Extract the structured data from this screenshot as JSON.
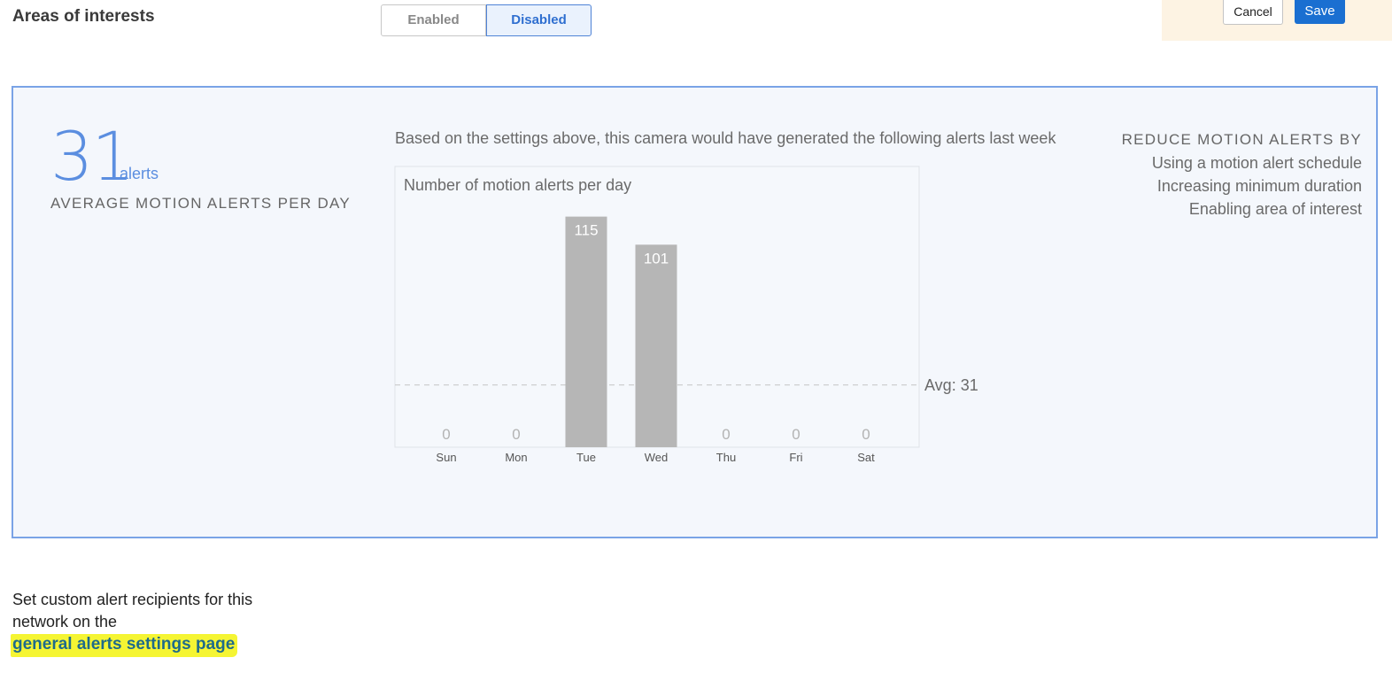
{
  "header": {
    "title": "Areas of interests",
    "toggle": {
      "enabled_label": "Enabled",
      "disabled_label": "Disabled",
      "selected": "Disabled"
    },
    "cancel_label": "Cancel",
    "save_label": "Save"
  },
  "summary": {
    "average_value": "31",
    "average_unit": "alerts",
    "average_caption": "AVERAGE MOTION ALERTS PER DAY",
    "chart_caption": "Based on the settings above, this camera would have generated the following alerts last week"
  },
  "reduce": {
    "heading": "REDUCE MOTION ALERTS BY",
    "items": [
      "Using a motion alert schedule",
      "Increasing minimum duration",
      "Enabling area of interest"
    ]
  },
  "chart_data": {
    "type": "bar",
    "title": "Number of motion alerts per day",
    "categories": [
      "Sun",
      "Mon",
      "Tue",
      "Wed",
      "Thu",
      "Fri",
      "Sat"
    ],
    "values": [
      0,
      0,
      115,
      101,
      0,
      0,
      0
    ],
    "ylim": [
      0,
      140
    ],
    "average": 31,
    "average_label": "Avg: 31",
    "bar_color": "#b6b6b6",
    "grid": false
  },
  "footer": {
    "text": "Set custom alert recipients for this network on the",
    "link": "general alerts settings page"
  }
}
